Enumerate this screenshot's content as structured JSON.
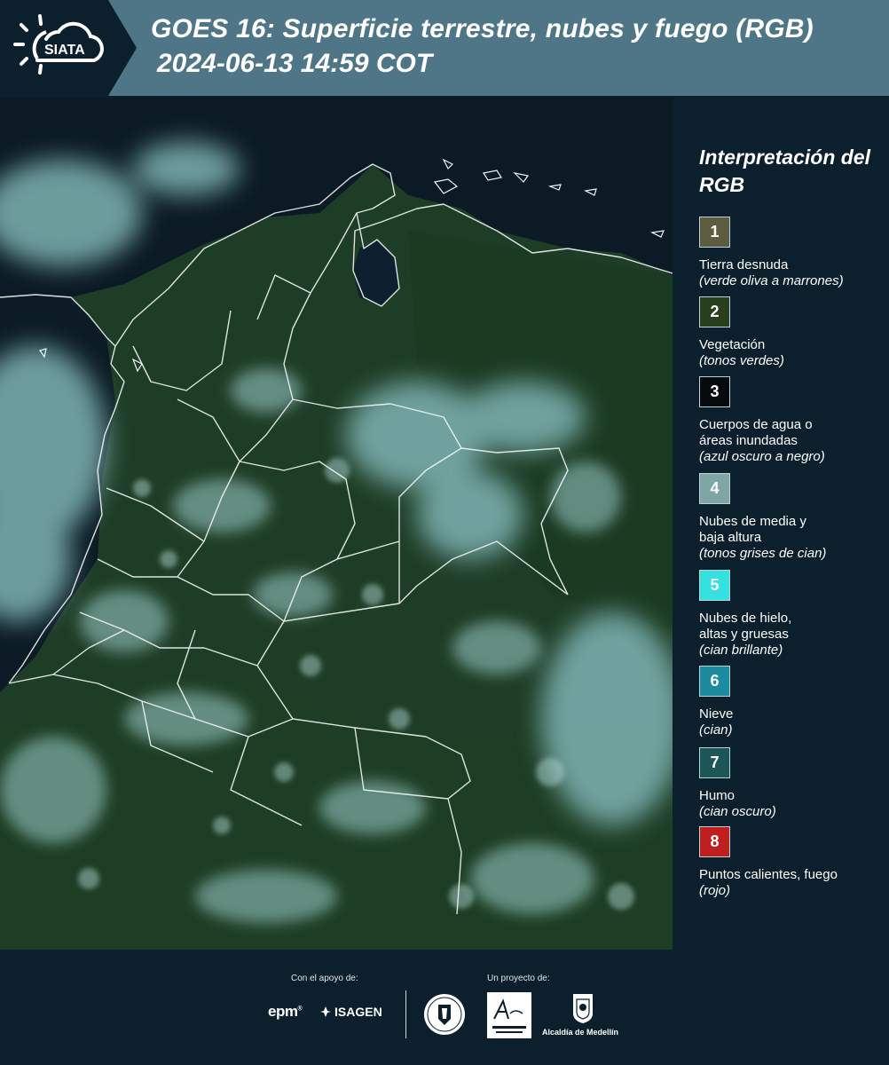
{
  "header": {
    "title": "GOES 16: Superficie terrestre, nubes y fuego (RGB)",
    "datetime": "2024-06-13 14:59 COT",
    "logo_text": "SIATA",
    "band_color": "#4e7686"
  },
  "map": {
    "description_icon": "satellite-rgb-map",
    "background_color": "#1c3b25",
    "ocean_color": "#0a1720"
  },
  "legend": {
    "title": "Interpretación del RGB",
    "items": [
      {
        "number": "1",
        "name": "Tierra desnuda",
        "desc": "(verde oliva a marrones)",
        "color": "#5e5c40"
      },
      {
        "number": "2",
        "name": "Vegetación",
        "desc": "(tonos verdes)",
        "color": "#29401f"
      },
      {
        "number": "3",
        "name": "Cuerpos de agua o\náreas inundadas",
        "desc": "(azul oscuro a negro)",
        "color": "#070a0c"
      },
      {
        "number": "4",
        "name": "Nubes de media y\nbaja altura",
        "desc": "(tonos grises de cian)",
        "color": "#7fa6a5"
      },
      {
        "number": "5",
        "name": "Nubes de hielo,\naltas y gruesas",
        "desc": "(cian brillante)",
        "color": "#34e0e0"
      },
      {
        "number": "6",
        "name": "Nieve",
        "desc": "(cian)",
        "color": "#1c8ba0"
      },
      {
        "number": "7",
        "name": "Humo",
        "desc": "(cian oscuro)",
        "color": "#1d5656"
      },
      {
        "number": "8",
        "name": "Puntos calientes, fuego",
        "desc": "(rojo)",
        "color": "#c01f1f"
      }
    ]
  },
  "footer": {
    "support_label": "Con el apoyo de:",
    "project_label": "Un proyecto de:",
    "epm": "epm",
    "isagen": "ISAGEN",
    "alcaldia": "Alcaldía de Medellín"
  }
}
